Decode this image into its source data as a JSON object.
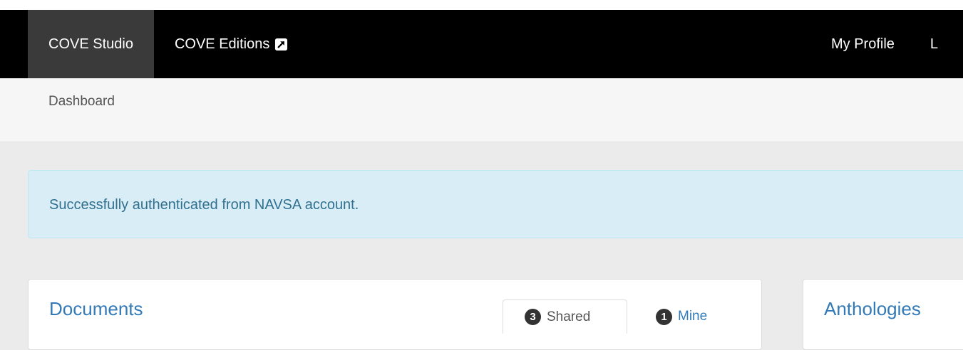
{
  "navbar": {
    "left_items": [
      {
        "label": "COVE Studio",
        "active": true
      },
      {
        "label": "COVE Editions",
        "icon": "external-link-icon"
      }
    ],
    "right_items": [
      {
        "label": "My Profile"
      },
      {
        "label": "L"
      }
    ]
  },
  "breadcrumb": {
    "label": "Dashboard"
  },
  "alert": {
    "message": "Successfully authenticated from NAVSA account."
  },
  "documents_panel": {
    "title": "Documents",
    "tabs": [
      {
        "count": "3",
        "label": "Shared",
        "active": true
      },
      {
        "count": "1",
        "label": "Mine",
        "active": false
      }
    ]
  },
  "anthologies_panel": {
    "title": "Anthologies"
  },
  "colors": {
    "navbar_bg": "#000000",
    "active_nav_bg": "#3a3a3a",
    "link_blue": "#337ab7",
    "alert_bg": "#d9edf7",
    "alert_text": "#31708f",
    "badge_bg": "#333333"
  }
}
